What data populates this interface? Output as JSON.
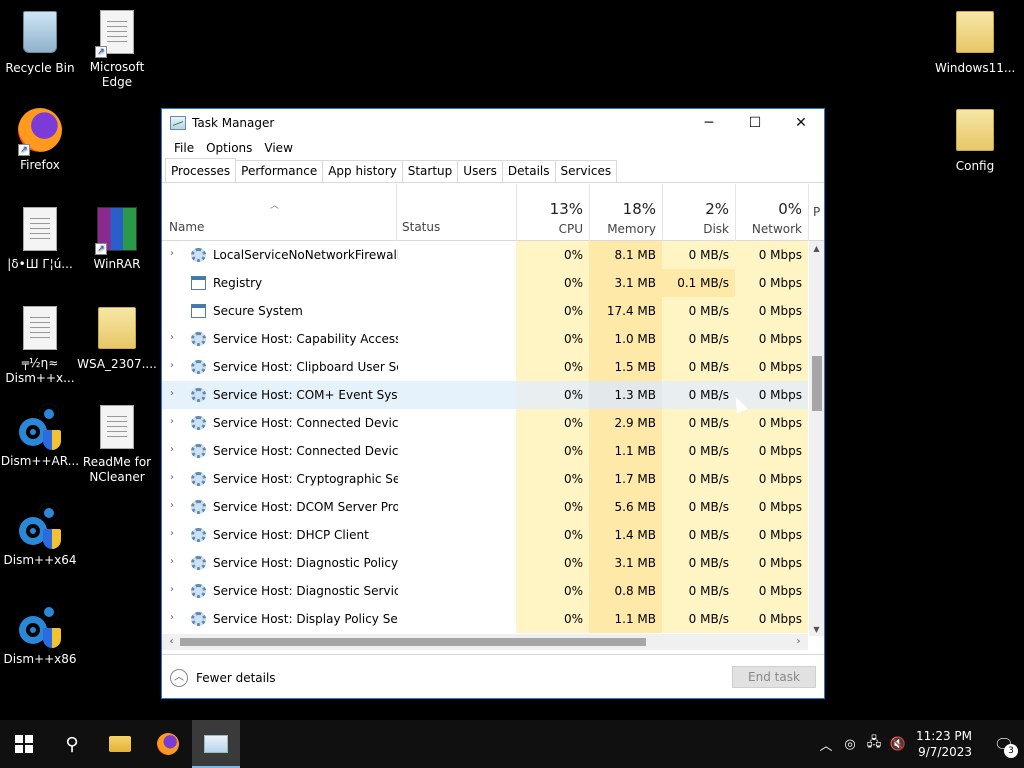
{
  "desktop": {
    "icons": [
      {
        "label": "Recycle Bin"
      },
      {
        "label": "Microsoft Edge"
      },
      {
        "label": "Firefox"
      },
      {
        "label": "|δ•Ш Г¦ú..."
      },
      {
        "label": "WinRAR"
      },
      {
        "label": "╤½η≈ Dism++x..."
      },
      {
        "label": "WSA_2307...."
      },
      {
        "label": "Dism++AR..."
      },
      {
        "label": "ReadMe for NCleaner"
      },
      {
        "label": "Dism++x64"
      },
      {
        "label": "Dism++x86"
      },
      {
        "label": "Windows11..."
      },
      {
        "label": "Config"
      }
    ]
  },
  "window": {
    "title": "Task Manager",
    "menu": [
      "File",
      "Options",
      "View"
    ],
    "tabs": [
      "Processes",
      "Performance",
      "App history",
      "Startup",
      "Users",
      "Details",
      "Services"
    ],
    "active_tab": "Processes",
    "columns": {
      "name": "Name",
      "status": "Status",
      "cpu": {
        "pct": "13%",
        "label": "CPU"
      },
      "memory": {
        "pct": "18%",
        "label": "Memory"
      },
      "disk": {
        "pct": "2%",
        "label": "Disk"
      },
      "network": {
        "pct": "0%",
        "label": "Network"
      },
      "power": {
        "label": "P"
      }
    },
    "rows": [
      {
        "name": "LocalServiceNoNetworkFirewall ...",
        "cpu": "0%",
        "memory": "8.1 MB",
        "disk": "0 MB/s",
        "network": "0 Mbps"
      },
      {
        "name": "Registry",
        "cpu": "0%",
        "memory": "3.1 MB",
        "disk": "0.1 MB/s",
        "network": "0 Mbps"
      },
      {
        "name": "Secure System",
        "cpu": "0%",
        "memory": "17.4 MB",
        "disk": "0 MB/s",
        "network": "0 Mbps"
      },
      {
        "name": "Service Host: Capability Access ...",
        "cpu": "0%",
        "memory": "1.0 MB",
        "disk": "0 MB/s",
        "network": "0 Mbps"
      },
      {
        "name": "Service Host: Clipboard User Ser...",
        "cpu": "0%",
        "memory": "1.5 MB",
        "disk": "0 MB/s",
        "network": "0 Mbps"
      },
      {
        "name": "Service Host: COM+ Event Syste...",
        "cpu": "0%",
        "memory": "1.3 MB",
        "disk": "0 MB/s",
        "network": "0 Mbps"
      },
      {
        "name": "Service Host: Connected Device...",
        "cpu": "0%",
        "memory": "2.9 MB",
        "disk": "0 MB/s",
        "network": "0 Mbps"
      },
      {
        "name": "Service Host: Connected Device...",
        "cpu": "0%",
        "memory": "1.1 MB",
        "disk": "0 MB/s",
        "network": "0 Mbps"
      },
      {
        "name": "Service Host: Cryptographic Ser...",
        "cpu": "0%",
        "memory": "1.7 MB",
        "disk": "0 MB/s",
        "network": "0 Mbps"
      },
      {
        "name": "Service Host: DCOM Server Proc...",
        "cpu": "0%",
        "memory": "5.6 MB",
        "disk": "0 MB/s",
        "network": "0 Mbps"
      },
      {
        "name": "Service Host: DHCP Client",
        "cpu": "0%",
        "memory": "1.4 MB",
        "disk": "0 MB/s",
        "network": "0 Mbps"
      },
      {
        "name": "Service Host: Diagnostic Policy ...",
        "cpu": "0%",
        "memory": "3.1 MB",
        "disk": "0 MB/s",
        "network": "0 Mbps"
      },
      {
        "name": "Service Host: Diagnostic Service...",
        "cpu": "0%",
        "memory": "0.8 MB",
        "disk": "0 MB/s",
        "network": "0 Mbps"
      },
      {
        "name": "Service Host: Display Policy Serv...",
        "cpu": "0%",
        "memory": "1.1 MB",
        "disk": "0 MB/s",
        "network": "0 Mbps"
      }
    ],
    "footer": {
      "fewer_details": "Fewer details",
      "end_task": "End task"
    }
  },
  "taskbar": {
    "time": "11:23 PM",
    "date": "9/7/2023",
    "notification_count": "3"
  }
}
